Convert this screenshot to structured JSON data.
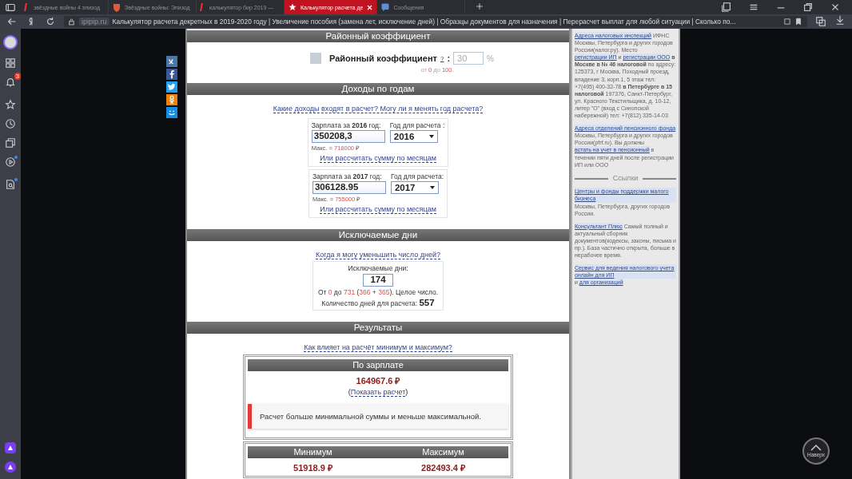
{
  "browser": {
    "tabs": [
      {
        "title": "звёздные войны 4 эпизод",
        "kind": "yandex",
        "selected": false
      },
      {
        "title": "Звёздные войны: Эпизод",
        "kind": "shield",
        "selected": false
      },
      {
        "title": "калькулятор бир 2019 —",
        "kind": "yandex",
        "selected": false
      },
      {
        "title": "Калькулятор расчета де",
        "kind": "star",
        "selected": true
      },
      {
        "title": "Сообщения",
        "kind": "chat",
        "selected": false
      }
    ],
    "domain": "ipipip.ru",
    "page_title": "Калькулятор расчета декретных в 2019-2020 году | Увеличение пособия (замена лет, исключение дней) | Образцы документов для назначения | Перерасчет выплат для любой ситуации | Сколько по...",
    "notification_count": "3"
  },
  "social": [
    {
      "kind": "vk"
    },
    {
      "kind": "facebook"
    },
    {
      "kind": "twitter"
    },
    {
      "kind": "odnoklassniki"
    },
    {
      "kind": "moimir"
    }
  ],
  "region": {
    "title": "Районный коэффициент",
    "checked": false,
    "label": "Районный коэффициент",
    "help": "?",
    "colon": ":",
    "value": "30",
    "disabled": true,
    "unit": "%",
    "hint": [
      {
        "text": "от ",
        "accent": false
      },
      {
        "text": "0",
        "accent": true
      },
      {
        "text": " до ",
        "accent": false
      },
      {
        "text": "100.",
        "accent": true
      }
    ]
  },
  "income": {
    "title": "Доходы по годам",
    "link": "Какие доходы входят в расчет? Могу ли я менять год расчета?",
    "years": [
      {
        "label": "Зарплата за **2016** год:",
        "year_label": "Год для расчета :",
        "value": "350208,3",
        "year": "2016",
        "max_prefix": "Макс. = ",
        "max": "718000",
        "currency": "₽",
        "monthly_link": "Или рассчитать сумму по месяцам"
      },
      {
        "label": "Зарплата за **2017** год:",
        "year_label": "Год для расчета:",
        "value": "306128.95",
        "year": "2017",
        "max_prefix": "Макс. = ",
        "max": "755000",
        "currency": "₽",
        "monthly_link": "Или рассчитать сумму по месяцам"
      }
    ]
  },
  "excluded": {
    "title": "Исключаемые дни",
    "link": "Когда я могу уменьшить число дней?",
    "label": "Исключаемые дни:",
    "value": "174",
    "hint": [
      {
        "text": "От ",
        "accent": false
      },
      {
        "text": "0",
        "accent": true
      },
      {
        "text": " до ",
        "accent": false
      },
      {
        "text": "731",
        "accent": true
      },
      {
        "text": " (",
        "accent": false
      },
      {
        "text": "366",
        "accent": true
      },
      {
        "text": " + ",
        "accent": false
      },
      {
        "text": "365",
        "accent": true
      },
      {
        "text": "). Целое число.",
        "accent": false
      }
    ],
    "days_label": "Количество дней для расчета:",
    "days": "557"
  },
  "results": {
    "title": "Результаты",
    "link": "Как влияет на расчёт минимум и максимум?",
    "salary_title": "По зарплате",
    "amount": "164967.6 ₽",
    "show_open": "(",
    "show_link": "Показать расчет",
    "show_close": ")",
    "notice": "Расчет больше минимальной суммы и меньше максимальной.",
    "limits": [
      {
        "title": "Минимум",
        "value": "51918.9 ₽"
      },
      {
        "title": "Максимум",
        "value": "282493.4 ₽"
      }
    ]
  },
  "sidebar": {
    "blocks": [
      [
        {
          "text": "Адреса налоговых инспекций",
          "kind": "link"
        },
        {
          "text": " ИФНС Москвы, Петербурга и других городов России(налог.ру). Место ",
          "kind": "plain"
        },
        {
          "text": "регистрации ИП",
          "kind": "link"
        },
        {
          "text": " и ",
          "kind": "plain"
        },
        {
          "text": "регистрации ООО",
          "kind": "link"
        },
        {
          "text": " в Москве в № 46 налоговой",
          "kind": "bold"
        },
        {
          "text": " по адресу: 125373, г Москва, Походный проезд, владение 3, корп.1, 5 этаж тел: +7(495) 400-32-78 ",
          "kind": "plain"
        },
        {
          "text": "в Петербурге в 15 налоговой",
          "kind": "bold"
        },
        {
          "text": " 197376, Санкт-Петербург, ул. Красного Текстильщика, д. 10-12, литер \"О\" (вход с Синопской набережной) тел: +7(812) 335-14-03",
          "kind": "plain"
        }
      ],
      [
        {
          "text": "Адреса отделений пенсионного фонда",
          "kind": "link"
        },
        {
          "text": " Москвы, Петербурга и других городов России(pfrf.ru). Вы должны ",
          "kind": "plain"
        },
        {
          "text": "встать на учет в пенсионный",
          "kind": "link"
        },
        {
          "text": " в течении пяти дней после регистрации ИП или ООО",
          "kind": "plain"
        }
      ]
    ],
    "links_title": "Ссылки",
    "link_blocks": [
      [
        {
          "text": "Центры и фонды поддержки малого бизнеса",
          "kind": "link"
        },
        {
          "text": " Москвы, Петербурга, других городов России.",
          "kind": "plain"
        }
      ],
      [
        {
          "text": "Консультант Плюс",
          "kind": "link"
        },
        {
          "text": " Самый полный и актуальный сборник документов(кодексы, законы, письма и пр.). База частично открыта, больше в нерабочее время.",
          "kind": "plain"
        }
      ],
      [
        {
          "text": "Сервис для ведения налогового учета онлайн для ИП",
          "kind": "link"
        },
        {
          "text": " и ",
          "kind": "plain"
        },
        {
          "text": "для организаций",
          "kind": "link"
        }
      ]
    ]
  },
  "to_top": "Наверх"
}
